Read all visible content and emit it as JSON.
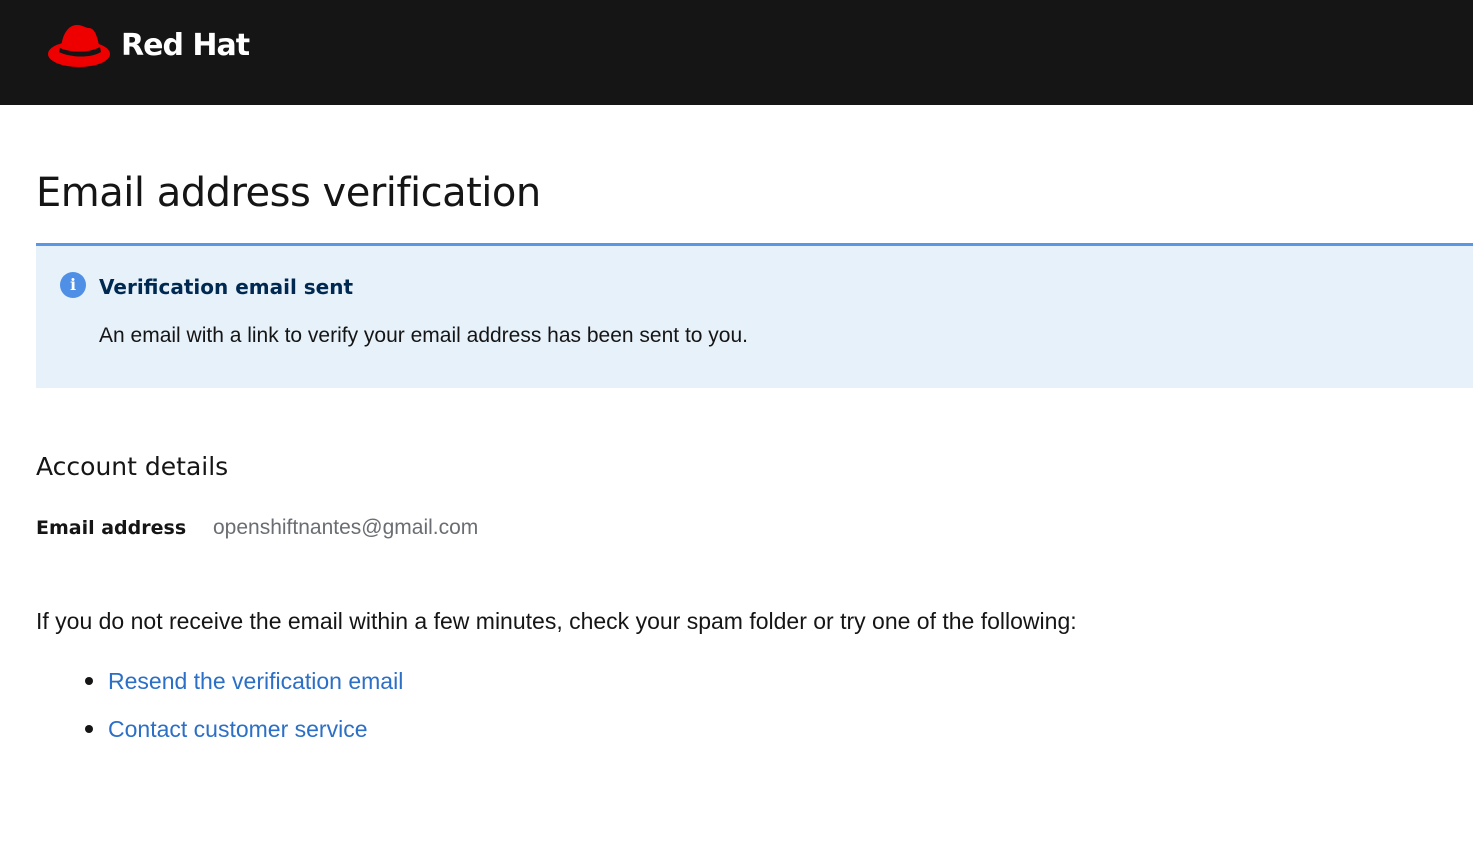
{
  "header": {
    "brand": "Red Hat",
    "logo_icon": "red-hat-fedora-icon",
    "background_color": "#151515",
    "logo_color": "#ee0000"
  },
  "main": {
    "title": "Email address verification",
    "alert": {
      "icon": "info-circle-icon",
      "title": "Verification email sent",
      "message": "An email with a link to verify your email address has been sent to you.",
      "background_color": "#e7f1fa",
      "accent_color": "#5a96e3"
    },
    "account_details": {
      "heading": "Account details",
      "email_label": "Email address",
      "email_value": "openshiftnantes@gmail.com"
    },
    "instructions": "If you do not receive the email within a few minutes, check your spam folder or try one of the following:",
    "options": [
      {
        "label": "Resend the verification email"
      },
      {
        "label": "Contact customer service"
      }
    ],
    "link_color": "#2b6fc6"
  }
}
